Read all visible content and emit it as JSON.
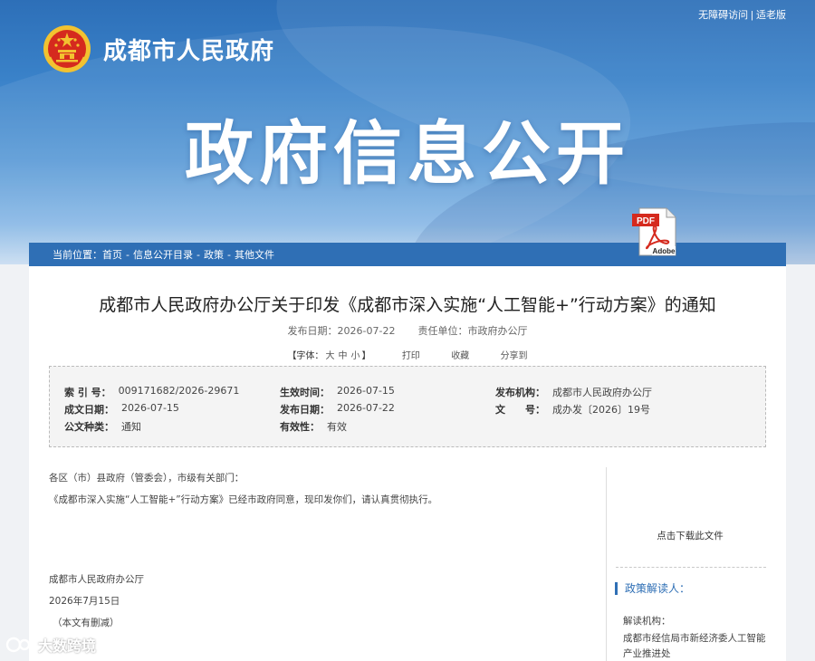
{
  "top_links": {
    "accessible": "无障碍访问",
    "separator": "|",
    "elder": "适老版"
  },
  "site": {
    "name": "成都市人民政府"
  },
  "banner": {
    "title": "政府信息公开"
  },
  "breadcrumb": {
    "label": "当前位置：",
    "items": [
      "首页",
      "信息公开目录",
      "政策",
      "其他文件"
    ],
    "separator": "-"
  },
  "article": {
    "title": "成都市人民政府办公厅关于印发《成都市深入实施“人工智能+”行动方案》的通知",
    "publish_label": "发布日期：",
    "publish_date": "2026-07-22",
    "unit_label": "责任单位：",
    "unit": "市政府办公厅",
    "font_label": "【字体：",
    "font_sizes": [
      "大",
      "中",
      "小"
    ],
    "font_close": "】",
    "print": "打印",
    "favorite": "收藏",
    "share": "分享到"
  },
  "info": {
    "index_k": "索 引 号：",
    "index_v": "009171682/2026-29671",
    "effective_k": "生效时间：",
    "effective_v": "2026-07-15",
    "issuer_k": "发布机构：",
    "issuer_v": "成都市人民政府办公厅",
    "written_k": "成文日期：",
    "written_v": "2026-07-15",
    "pub_k": "发布日期：",
    "pub_v": "2026-07-22",
    "docno_k": "文　　号：",
    "docno_v": "成办发〔2026〕19号",
    "type_k": "公文种类：",
    "type_v": "通知",
    "valid_k": "有效性：",
    "valid_v": "有效"
  },
  "body": {
    "greeting": "各区（市）县政府（管委会），市级有关部门：",
    "para1": "《成都市深入实施“人工智能+”行动方案》已经市政府同意，现印发你们，请认真贯彻执行。",
    "sign": "成都市人民政府办公厅",
    "date": "2026年7月15日",
    "note": "（本文有删减）"
  },
  "sidebar": {
    "pdf_badge": "PDF",
    "adobe": "Adobe",
    "download": "点击下载此文件",
    "reader_title": "政策解读人：",
    "org_label": "解读机构：",
    "org_value": "成都市经信局市新经济委人工智能产业推进处"
  },
  "watermark": {
    "text": "大数跨境"
  },
  "colors": {
    "primary": "#2f6fb5",
    "emblem_red": "#d52a1e",
    "emblem_gold": "#f2c230"
  }
}
